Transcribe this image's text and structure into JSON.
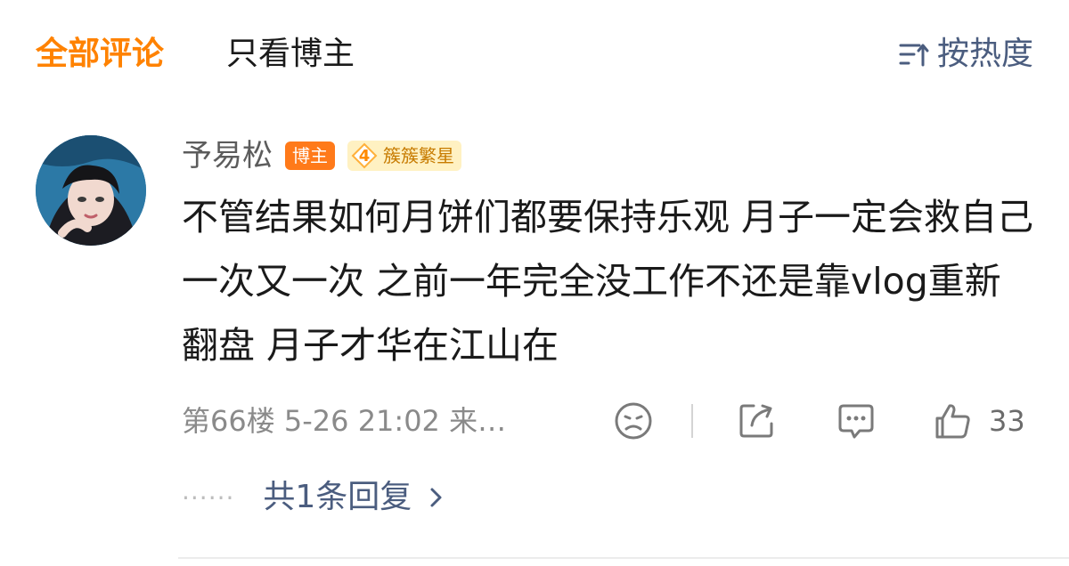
{
  "tabs": {
    "all_comments": "全部评论",
    "owner_only": "只看博主",
    "sort_label": "按热度"
  },
  "comment": {
    "username": "予易松",
    "owner_badge": "博主",
    "level": "4",
    "level_title": "簇簇繁星",
    "text": "不管结果如何月饼们都要保持乐观 月子一定会救自己一次又一次 之前一年完全没工作不还是靠vlog重新翻盘 月子才华在江山在",
    "meta": "第66楼 5-26 21:02 来…",
    "like_count": "33",
    "reply_summary": "共1条回复"
  },
  "colors": {
    "accent": "#ff8200",
    "link": "#4b5d7f",
    "owner_badge": "#ff7a1a",
    "level_badge_bg": "#fff1c2"
  },
  "icons": [
    "sort-icon",
    "dislike-icon",
    "share-icon",
    "reply-icon",
    "like-icon",
    "chevron-right-icon"
  ]
}
